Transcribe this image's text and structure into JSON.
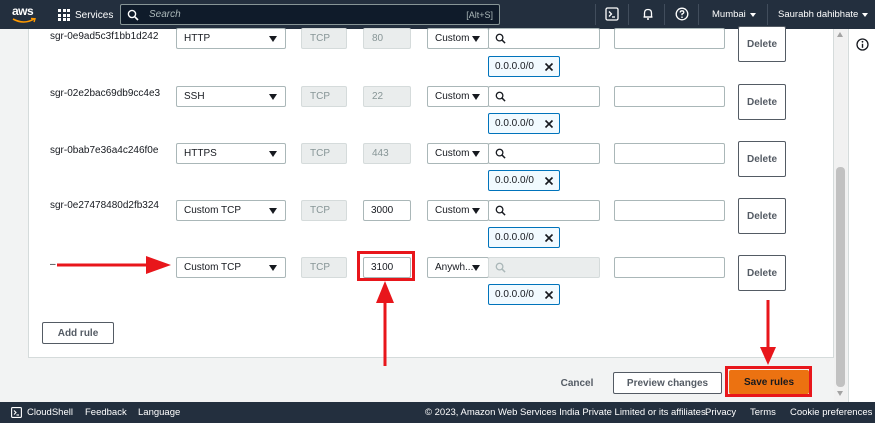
{
  "topnav": {
    "logo_text": "aws",
    "services_label": "Services",
    "search_placeholder": "Search",
    "search_shortcut": "[Alt+S]",
    "region_label": "Mumbai",
    "account_label": "Saurabh dahibhate"
  },
  "rules": [
    {
      "id": "sgr-0e9ad5c3f1bb1d242",
      "type": "HTTP",
      "protocol": "TCP",
      "port": "80",
      "source_type": "Custom",
      "cidr": "0.0.0.0/0",
      "delete_label": "Delete"
    },
    {
      "id": "sgr-02e2bac69db9cc4e3",
      "type": "SSH",
      "protocol": "TCP",
      "port": "22",
      "source_type": "Custom",
      "cidr": "0.0.0.0/0",
      "delete_label": "Delete"
    },
    {
      "id": "sgr-0bab7e36a4c246f0e",
      "type": "HTTPS",
      "protocol": "TCP",
      "port": "443",
      "source_type": "Custom",
      "cidr": "0.0.0.0/0",
      "delete_label": "Delete"
    },
    {
      "id": "sgr-0e27478480d2fb324",
      "type": "Custom TCP",
      "protocol": "TCP",
      "port": "3000",
      "source_type": "Custom",
      "cidr": "0.0.0.0/0",
      "delete_label": "Delete"
    },
    {
      "id": "–",
      "type": "Custom TCP",
      "protocol": "TCP",
      "port": "3100",
      "source_type": "Anywh...",
      "cidr": "0.0.0.0/0",
      "delete_label": "Delete"
    }
  ],
  "add_rule_label": "Add rule",
  "actions": {
    "cancel_label": "Cancel",
    "preview_label": "Preview changes",
    "save_label": "Save rules"
  },
  "footer": {
    "cloudshell_label": "CloudShell",
    "feedback_label": "Feedback",
    "language_label": "Language",
    "copyright": "© 2023, Amazon Web Services India Private Limited or its affiliates.",
    "privacy_label": "Privacy",
    "terms_label": "Terms",
    "cookie_label": "Cookie preferences"
  },
  "colors": {
    "nav_bg": "#232f3e",
    "primary": "#ec7211",
    "token_border": "#0073bb",
    "annotation": "#e8161b"
  }
}
